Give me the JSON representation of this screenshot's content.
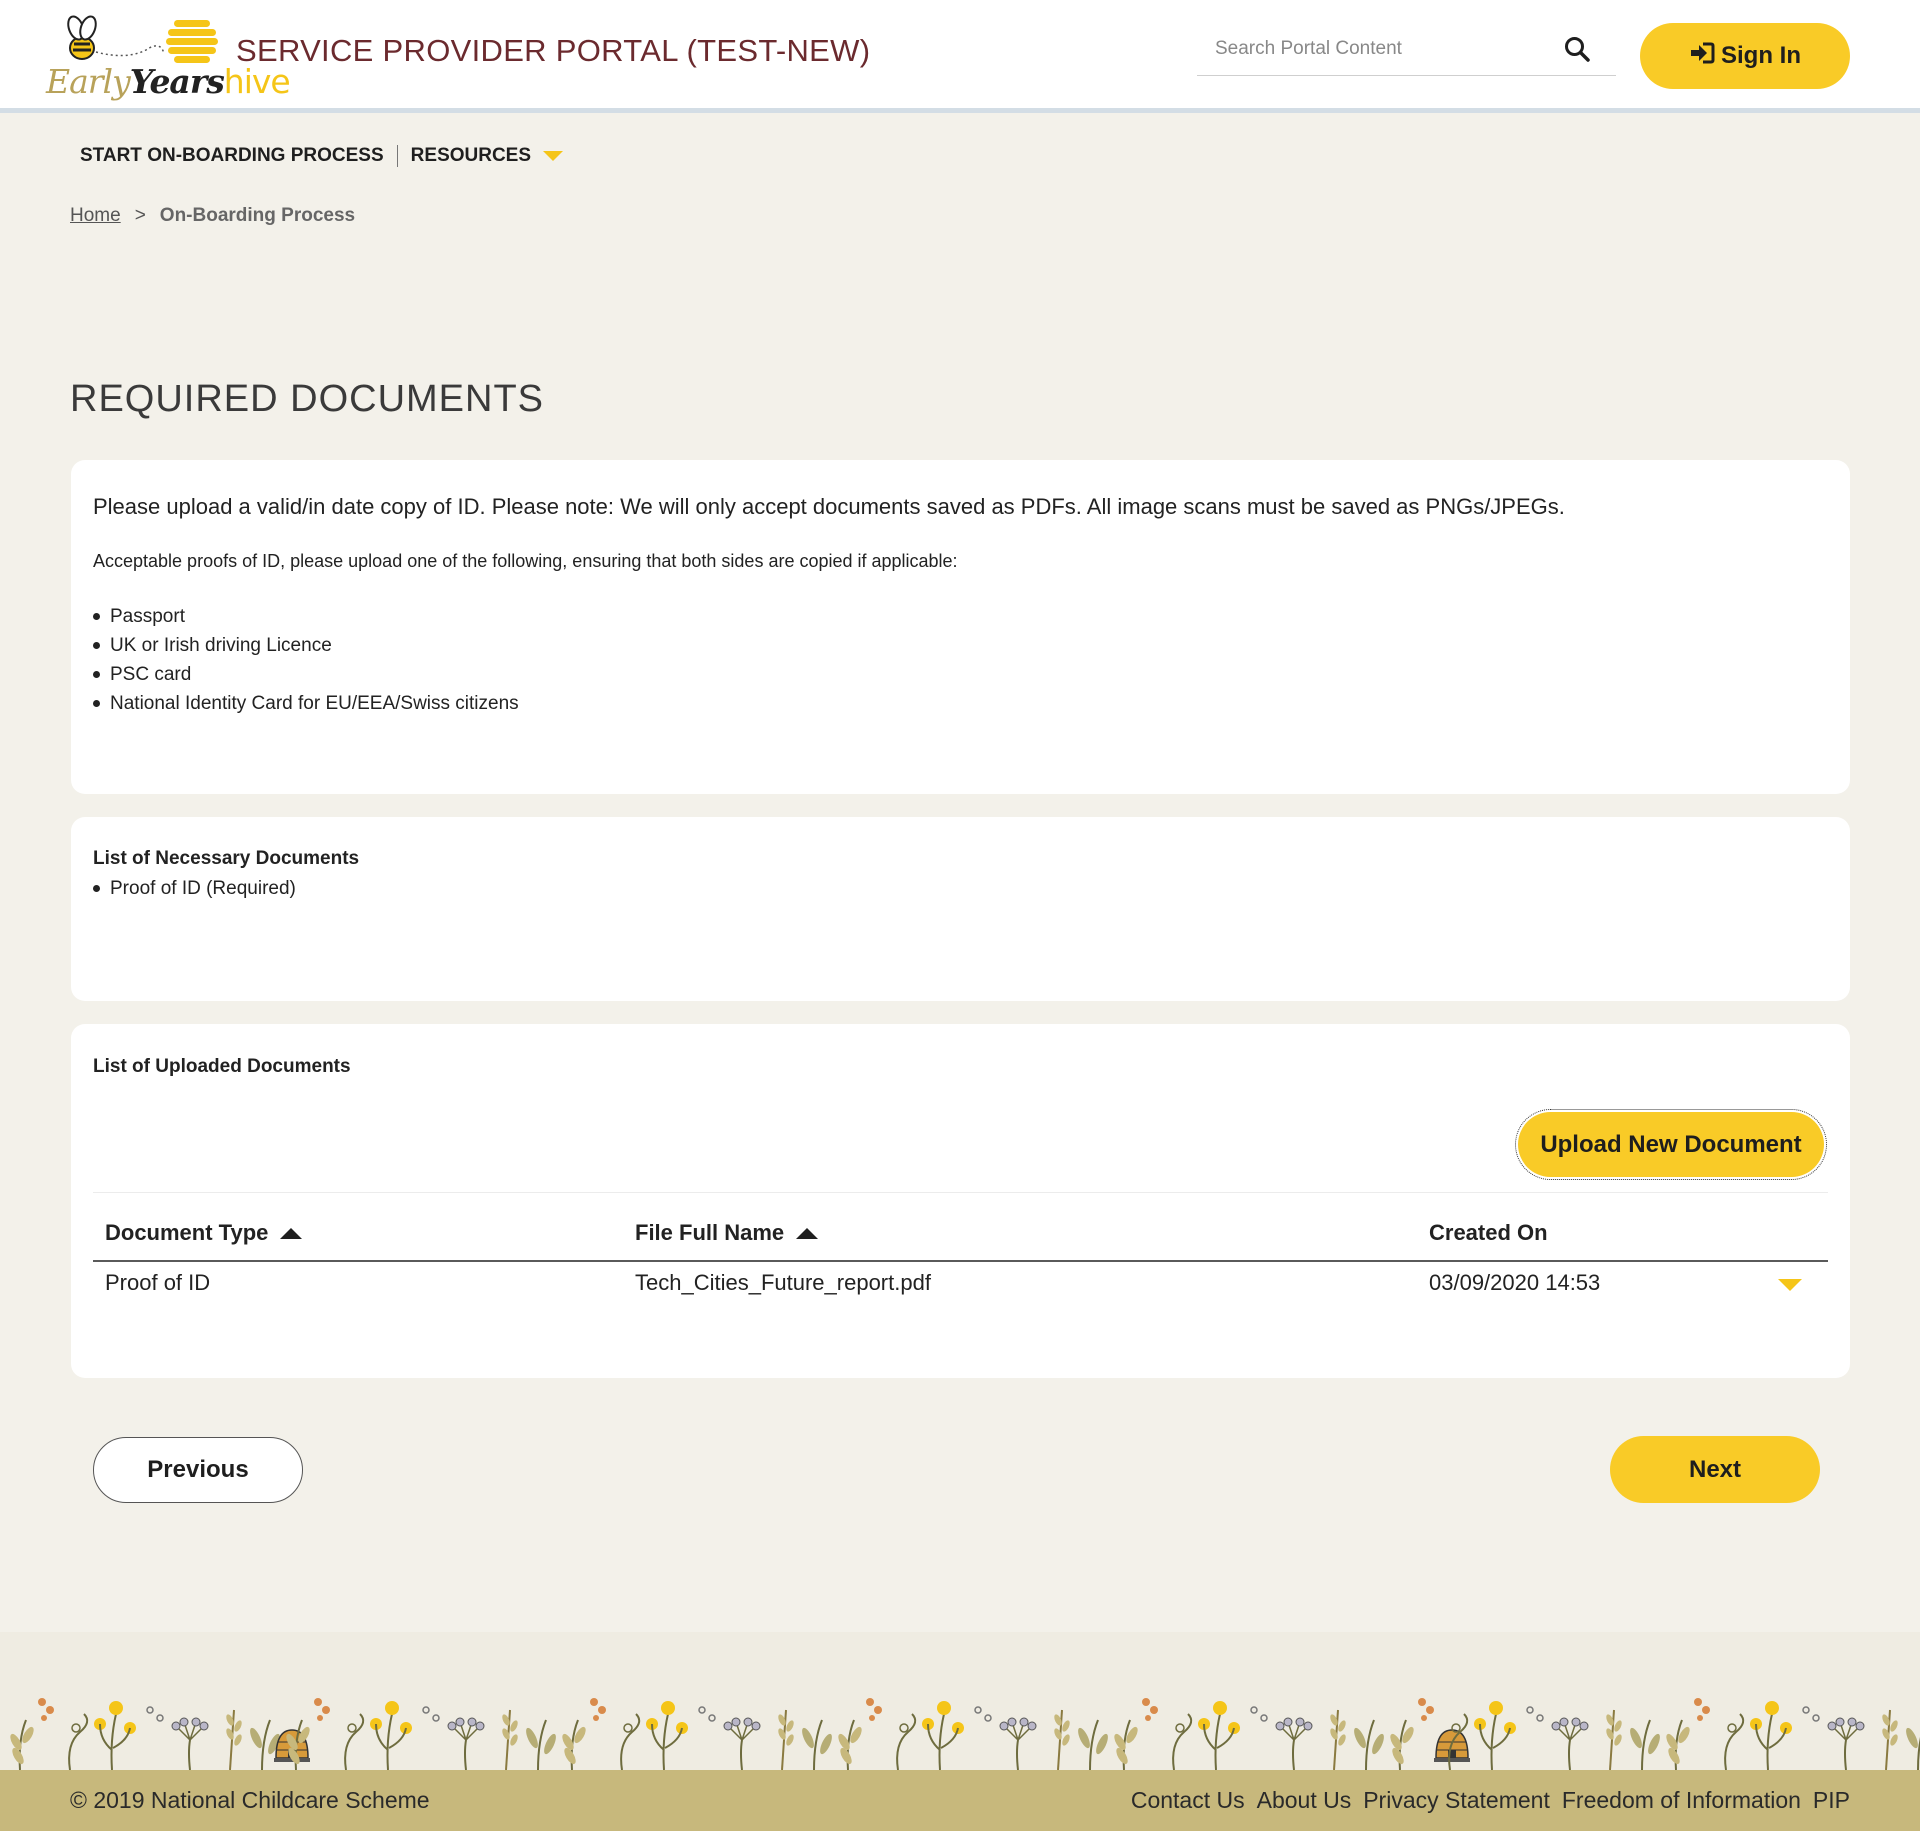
{
  "header": {
    "logo_text": [
      "Early",
      "Years",
      "hive"
    ],
    "portal_title": "SERVICE PROVIDER PORTAL (TEST-NEW)",
    "search_placeholder": "Search Portal Content",
    "signin_label": "Sign In",
    "brand_color": "#f9cb27",
    "title_color": "#6b2a2e"
  },
  "nav": {
    "items": [
      {
        "label": "START ON-BOARDING PROCESS"
      },
      {
        "label": "RESOURCES",
        "has_dropdown": true
      }
    ]
  },
  "breadcrumb": {
    "home": "Home",
    "separator": ">",
    "current": "On-Boarding Process"
  },
  "page": {
    "title": "REQUIRED DOCUMENTS"
  },
  "instructions": {
    "intro": "Please upload a valid/in date copy of ID. Please note: We will only accept documents saved as PDFs. All image scans must be saved as PNGs/JPEGs.",
    "acceptable": "Acceptable proofs of ID, please upload one of the following, ensuring that both sides are copied if applicable:",
    "items": [
      "Passport",
      "UK or Irish driving Licence",
      "PSC card",
      "National Identity Card for EU/EEA/Swiss citizens"
    ]
  },
  "necessary": {
    "heading": "List of Necessary Documents",
    "items": [
      "Proof of ID (Required)"
    ]
  },
  "uploaded": {
    "heading": "List of Uploaded Documents",
    "upload_label": "Upload New Document",
    "columns": [
      "Document Type",
      "File Full Name",
      "Created On"
    ],
    "rows": [
      {
        "document_type": "Proof of ID",
        "file_name": "Tech_Cities_Future_report.pdf",
        "created_on": "03/09/2020 14:53"
      }
    ]
  },
  "actions": {
    "previous": "Previous",
    "next": "Next"
  },
  "footer": {
    "copyright": "© 2019 National Childcare Scheme",
    "links": [
      "Contact Us",
      "About Us",
      "Privacy Statement",
      "Freedom of Information",
      "PIP"
    ]
  }
}
